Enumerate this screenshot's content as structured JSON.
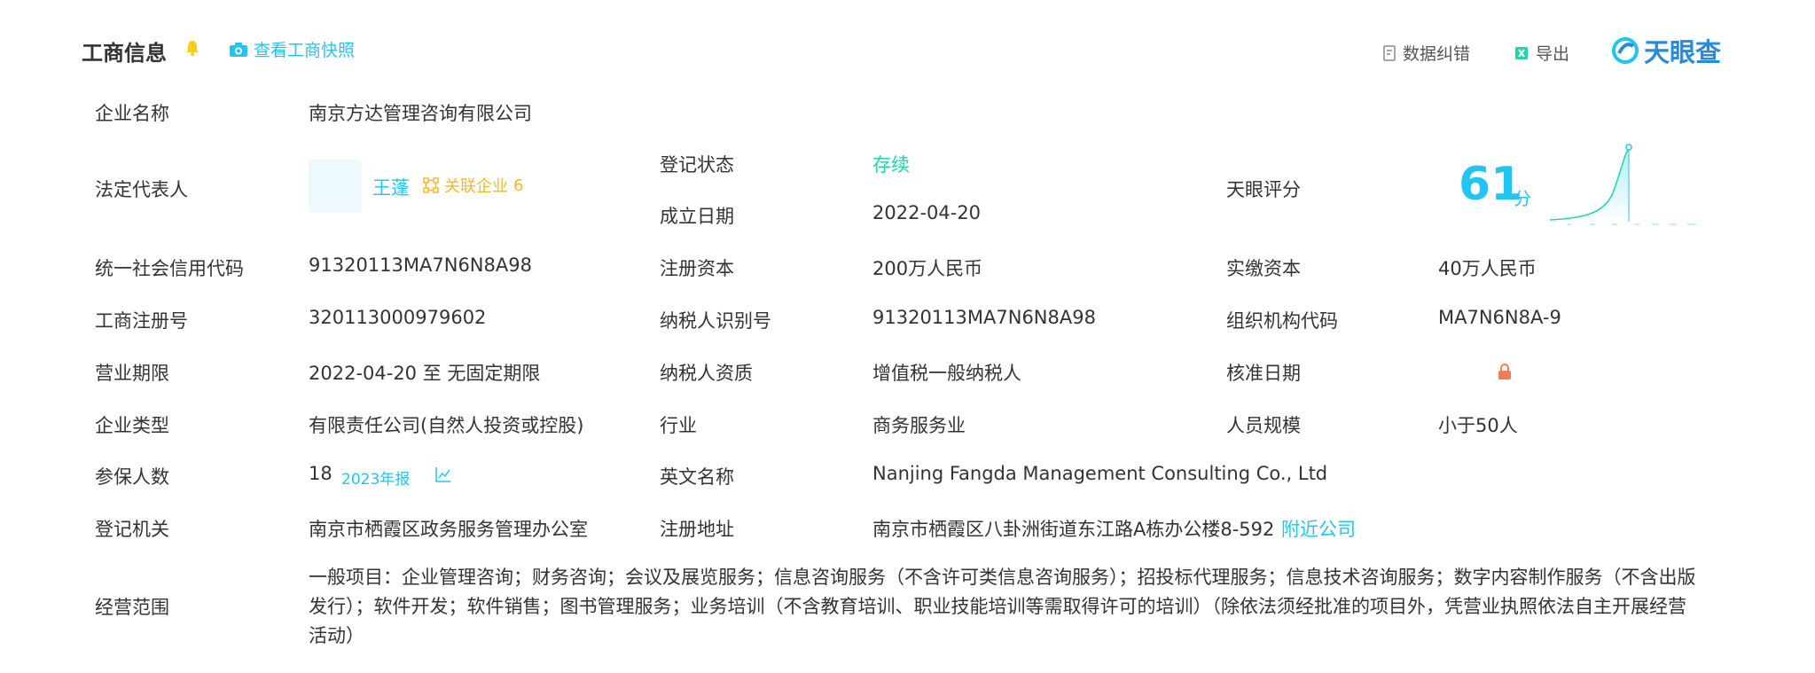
{
  "header": {
    "title": "工商信息",
    "snapshot_label": "查看工商快照",
    "report_label": "数据纠错",
    "export_label": "导出",
    "brand": "天眼查"
  },
  "labels": {
    "company_name": "企业名称",
    "legal_rep": "法定代表人",
    "reg_status": "登记状态",
    "founded": "成立日期",
    "tianyan_score": "天眼评分",
    "credit_code": "统一社会信用代码",
    "reg_capital": "注册资本",
    "paid_capital": "实缴资本",
    "reg_number": "工商注册号",
    "tax_id": "纳税人识别号",
    "org_code": "组织机构代码",
    "business_term": "营业期限",
    "taxpayer_qual": "纳税人资质",
    "approval_date": "核准日期",
    "company_type": "企业类型",
    "industry": "行业",
    "staff_size": "人员规模",
    "insured": "参保人数",
    "english_name": "英文名称",
    "reg_authority": "登记机关",
    "reg_address": "注册地址",
    "business_scope": "经营范围"
  },
  "values": {
    "company_name": "南京方达管理咨询有限公司",
    "legal_rep_name": "王蓬",
    "related_label": "关联企业",
    "related_count": "6",
    "reg_status": "存续",
    "founded": "2022-04-20",
    "score": "61",
    "score_unit": "分",
    "credit_code": "91320113MA7N6N8A98",
    "reg_capital": "200万人民币",
    "paid_capital": "40万人民币",
    "reg_number": "320113000979602",
    "tax_id": "91320113MA7N6N8A98",
    "org_code": "MA7N6N8A-9",
    "business_term": "2022-04-20 至 无固定期限",
    "taxpayer_qual": "增值税一般纳税人",
    "company_type": "有限责任公司(自然人投资或控股)",
    "industry": "商务服务业",
    "staff_size": "小于50人",
    "insured_count": "18",
    "annual_report": "2023年报",
    "english_name": "Nanjing Fangda Management Consulting Co., Ltd",
    "reg_authority": "南京市栖霞区政务服务管理办公室",
    "reg_address": "南京市栖霞区八卦洲街道东江路A栋办公楼8-592",
    "nearby_link": "附近公司",
    "business_scope": "一般项目：企业管理咨询；财务咨询；会议及展览服务；信息咨询服务（不含许可类信息咨询服务）；招投标代理服务；信息技术咨询服务；数字内容制作服务（不含出版发行）；软件开发；软件销售；图书管理服务；业务培训（不含教育培训、职业技能培训等需取得许可的培训）（除依法须经批准的项目外，凭营业执照依法自主开展经营活动）"
  },
  "colors": {
    "accent": "#22c5f2",
    "status_green": "#1ed6a5",
    "related_orange": "#f6b82a",
    "lock_orange": "#f07d57"
  }
}
